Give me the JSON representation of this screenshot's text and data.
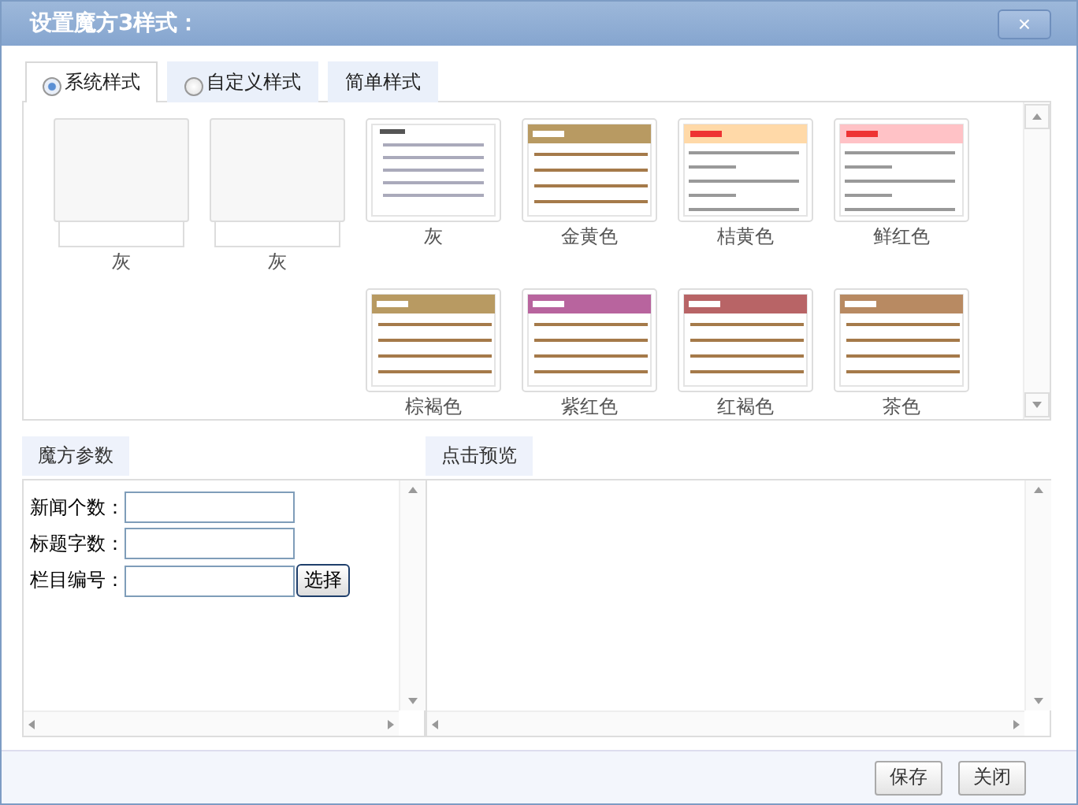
{
  "window": {
    "title": "设置魔方3样式：",
    "close": "×"
  },
  "tabs": [
    {
      "label": "系统样式",
      "kind": "radio",
      "selected": true
    },
    {
      "label": "自定义样式",
      "kind": "radio",
      "selected": false
    },
    {
      "label": "简单样式",
      "kind": "plain",
      "selected": false
    }
  ],
  "styles": [
    [
      {
        "label": "灰",
        "kind": "blank"
      },
      {
        "label": "灰",
        "kind": "blank"
      },
      {
        "label": "灰",
        "kind": "plain"
      },
      {
        "label": "金黄色",
        "kind": "bar",
        "color": "#b89a62"
      },
      {
        "label": "桔黄色",
        "kind": "news",
        "color": "#ffd9a8"
      },
      {
        "label": "鲜红色",
        "kind": "news",
        "color": "#ffc2c6"
      }
    ],
    [
      {
        "label": "棕褐色",
        "kind": "bar",
        "color": "#b89a62"
      },
      {
        "label": "紫红色",
        "kind": "bar",
        "color": "#b8649e"
      },
      {
        "label": "红褐色",
        "kind": "bar",
        "color": "#b86466"
      },
      {
        "label": "茶色",
        "kind": "bar",
        "color": "#b88a62"
      }
    ]
  ],
  "params": {
    "title": "魔方参数",
    "fields": [
      {
        "label": "新闻个数："
      },
      {
        "label": "标题字数："
      },
      {
        "label": "栏目编号：",
        "button": "选择"
      }
    ]
  },
  "preview": {
    "title": "点击预览"
  },
  "buttons": [
    "保存",
    "关闭"
  ]
}
